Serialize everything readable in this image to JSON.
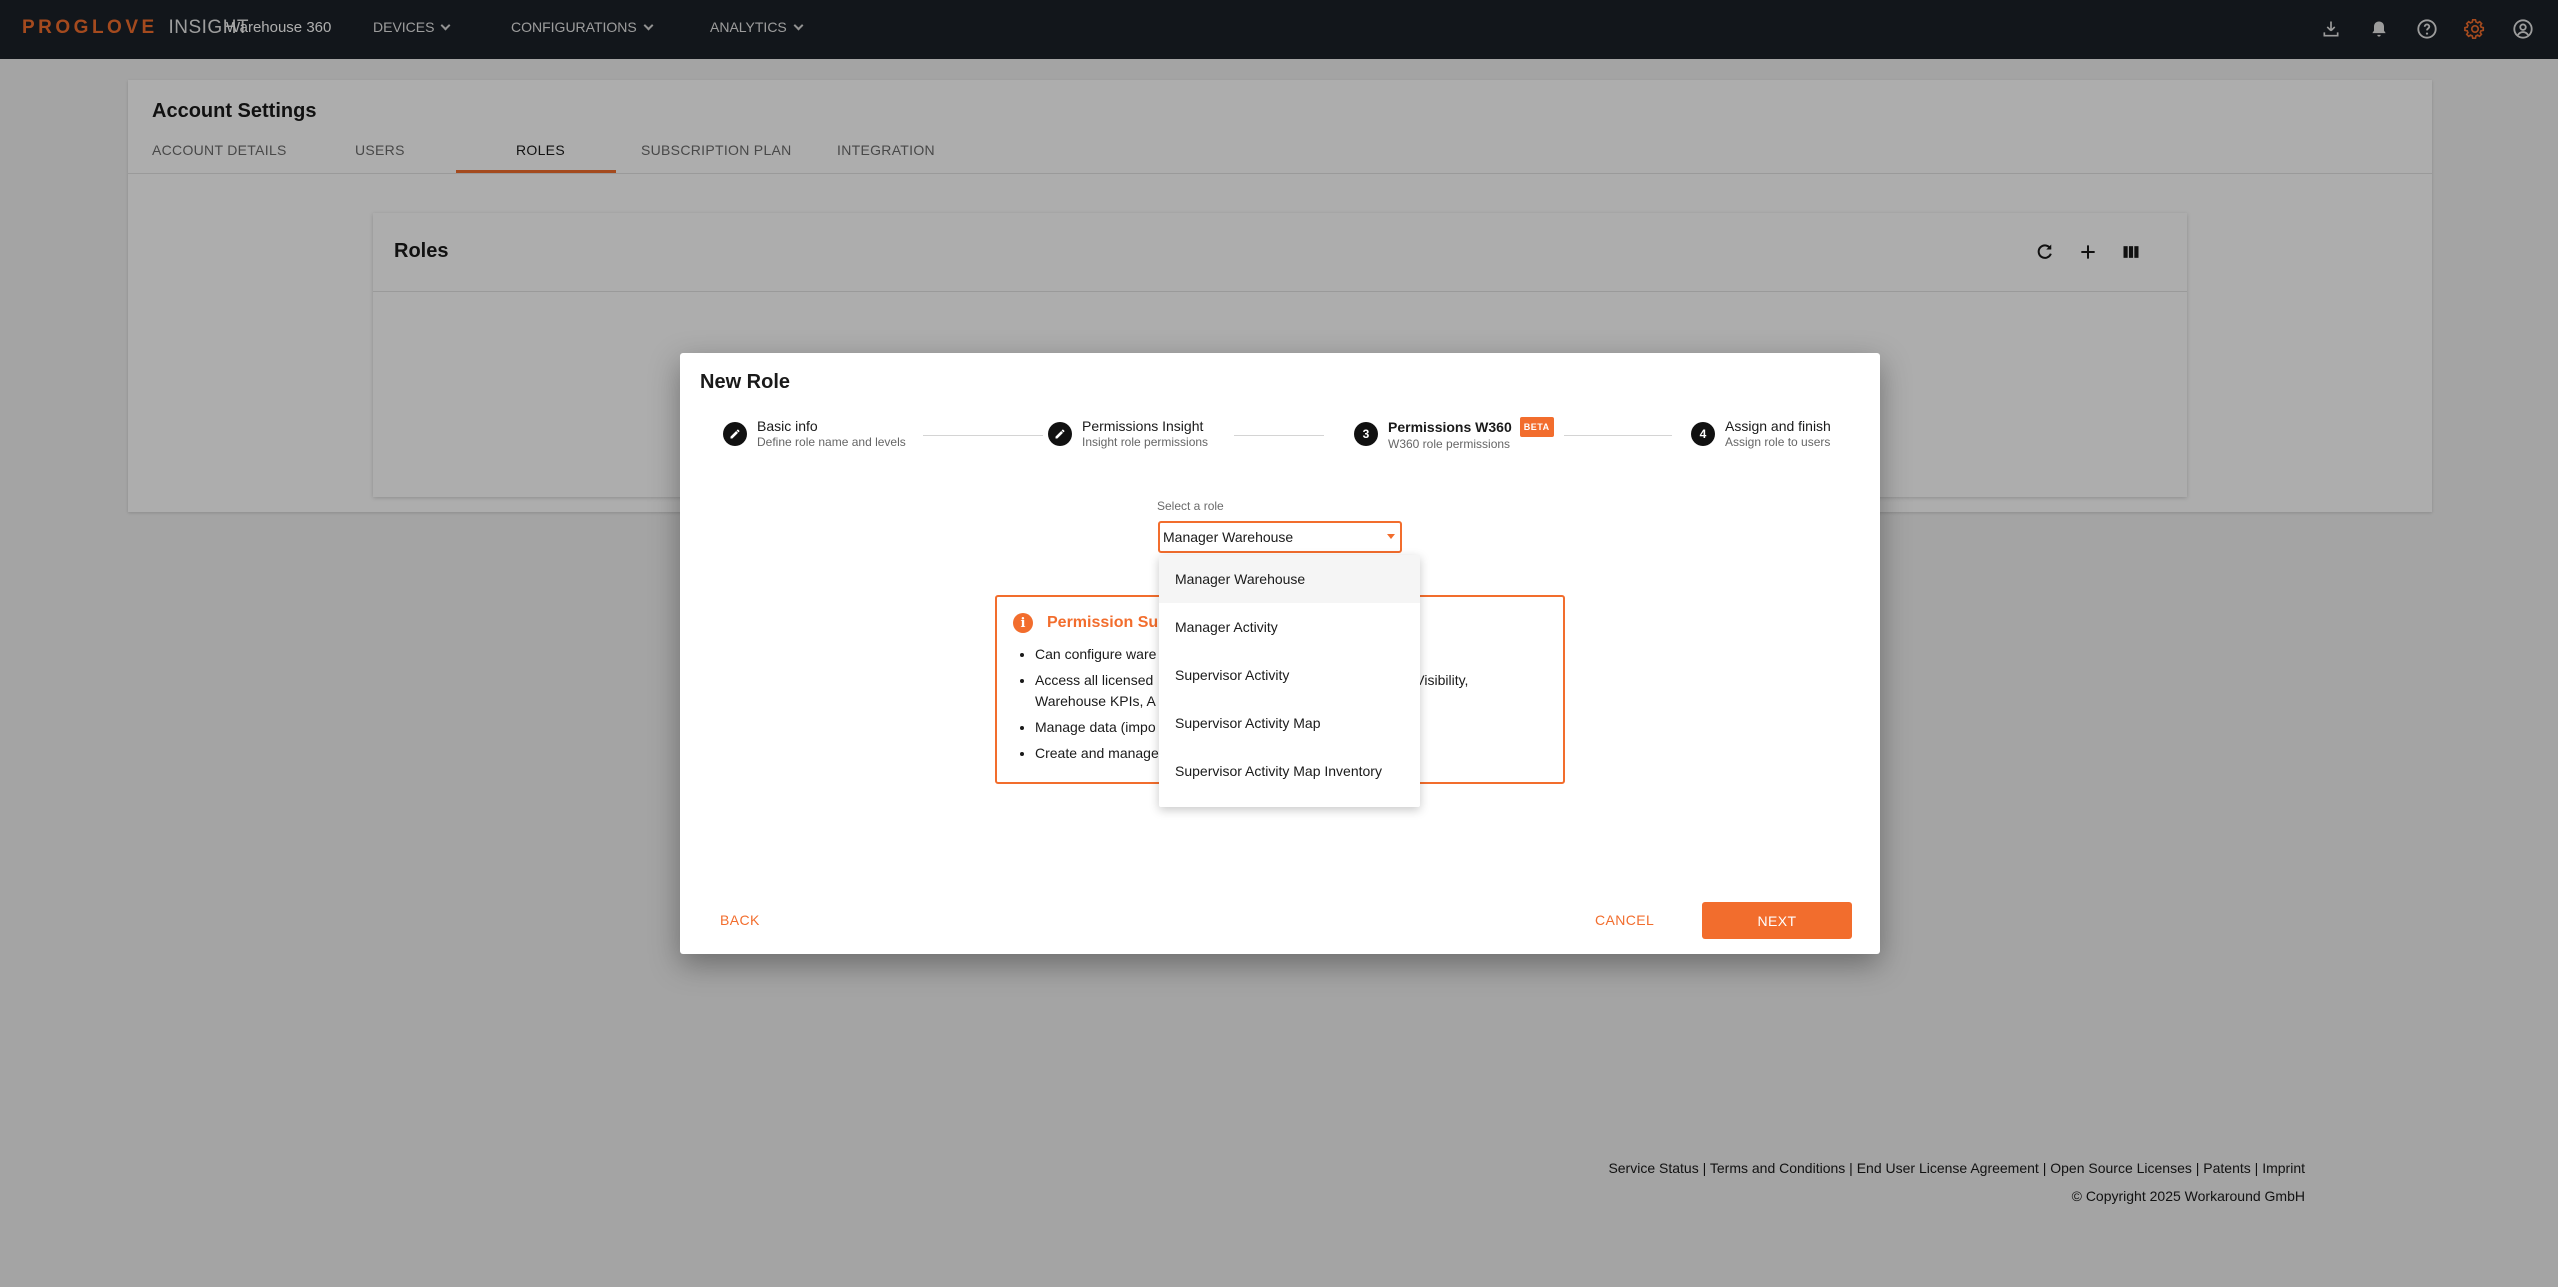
{
  "header": {
    "brand": "PROGLOVE",
    "brand_suffix": "INSIGHT",
    "product": "Warehouse 360",
    "nav": [
      {
        "label": "DEVICES"
      },
      {
        "label": "CONFIGURATIONS"
      },
      {
        "label": "ANALYTICS"
      }
    ],
    "icons": [
      "download-icon",
      "bell-icon",
      "help-icon",
      "gear-icon",
      "account-icon"
    ],
    "accent_color": "#f26d2d"
  },
  "page": {
    "title": "Account Settings",
    "tabs": [
      {
        "label": "ACCOUNT DETAILS"
      },
      {
        "label": "USERS"
      },
      {
        "label": "ROLES",
        "active": true
      },
      {
        "label": "SUBSCRIPTION PLAN"
      },
      {
        "label": "INTEGRATION"
      }
    ],
    "roles_card": {
      "title": "Roles",
      "icons": [
        "refresh-icon",
        "add-icon",
        "columns-icon"
      ]
    }
  },
  "modal": {
    "title": "New Role",
    "steps": [
      {
        "title": "Basic info",
        "subtitle": "Define role name and levels",
        "state": "done"
      },
      {
        "title": "Permissions Insight",
        "subtitle": "Insight role permissions",
        "state": "done"
      },
      {
        "number": "3",
        "title": "Permissions W360",
        "badge": "BETA",
        "subtitle": "W360 role permissions",
        "state": "active"
      },
      {
        "number": "4",
        "title": "Assign and finish",
        "subtitle": "Assign role to users",
        "state": "pending"
      }
    ],
    "select": {
      "label": "Select a role",
      "value": "Manager Warehouse",
      "options": [
        "Manager Warehouse",
        "Manager Activity",
        "Supervisor Activity",
        "Supervisor Activity Map",
        "Supervisor Activity Map Inventory"
      ]
    },
    "summary": {
      "title_visible": "Permission Su",
      "items_visible": [
        "Can configure ware",
        "Access all licensed",
        "Visibility,",
        "Warehouse KPIs, A",
        "Manage data (impo",
        "Create and manage"
      ]
    },
    "buttons": {
      "back": "BACK",
      "cancel": "CANCEL",
      "next": "NEXT"
    }
  },
  "footer": {
    "links": [
      "Service Status",
      "Terms and Conditions",
      "End User License Agreement",
      "Open Source Licenses",
      "Patents",
      "Imprint"
    ],
    "separator": " | ",
    "copyright": "© Copyright 2025 Workaround GmbH"
  }
}
